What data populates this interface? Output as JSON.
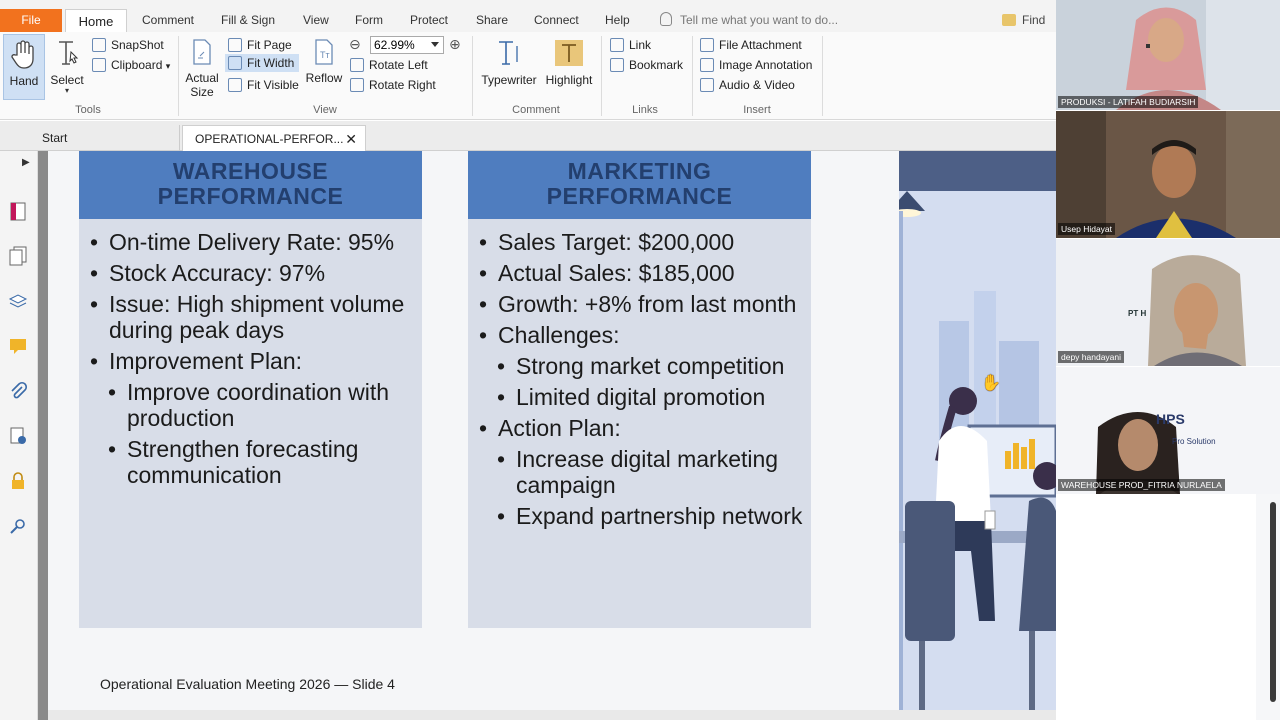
{
  "ribbon": {
    "tabs": [
      "File",
      "Home",
      "Comment",
      "Fill & Sign",
      "View",
      "Form",
      "Protect",
      "Share",
      "Connect",
      "Help"
    ],
    "tell_me": "Tell me what you want to do...",
    "find_label": "Find",
    "tools": {
      "hand": "Hand",
      "select": "Select",
      "snapshot": "SnapShot",
      "clipboard": "Clipboard",
      "group": "Tools"
    },
    "view": {
      "actual_size_1": "Actual",
      "actual_size_2": "Size",
      "fit_page": "Fit Page",
      "fit_width": "Fit Width",
      "fit_visible": "Fit Visible",
      "reflow": "Reflow",
      "zoom": "62.99%",
      "rotate_left": "Rotate Left",
      "rotate_right": "Rotate Right",
      "group": "View"
    },
    "comment": {
      "typewriter": "Typewriter",
      "highlight": "Highlight",
      "group": "Comment"
    },
    "links": {
      "link": "Link",
      "bookmark": "Bookmark",
      "group": "Links"
    },
    "insert": {
      "file_attachment": "File Attachment",
      "image_annotation": "Image Annotation",
      "audio_video": "Audio & Video",
      "group": "Insert"
    }
  },
  "doc_tabs": {
    "start": "Start",
    "active": "OPERATIONAL-PERFOR..."
  },
  "slide": {
    "warehouse": {
      "title_1": "WAREHOUSE",
      "title_2": "PERFORMANCE",
      "items": [
        "On-time Delivery Rate: 95%",
        "Stock Accuracy: 97%",
        "Issue: High shipment volume during peak days",
        "Improvement Plan:",
        " Improve coordination with production",
        "Strengthen forecasting communication"
      ]
    },
    "marketing": {
      "title_1": "MARKETING",
      "title_2": "PERFORMANCE",
      "items": [
        "Sales Target: $200,000",
        "Actual Sales: $185,000",
        "Growth: +8% from last month",
        "Challenges:",
        "Strong market competition",
        "Limited digital promotion",
        "Action Plan:",
        "Increase digital marketing campaign",
        "Expand partnership network"
      ]
    },
    "footer": "Operational Evaluation Meeting 2026 — Slide 4"
  },
  "participants": [
    {
      "name": "PRODUKSI - LATIFAH BUDIARSIH"
    },
    {
      "name": "Usep Hidayat"
    },
    {
      "name": "depy handayani"
    },
    {
      "name": "WAREHOUSE PROD_FITRIA NURLAELA"
    }
  ],
  "participant_bg_text": {
    "pt_h": "PT H",
    "hps": "HPS",
    "solution": "Pro Solution"
  },
  "colors": {
    "file_tab": "#f2721e",
    "header_blue": "#4f7dbf",
    "panel": "#d8dde8"
  }
}
